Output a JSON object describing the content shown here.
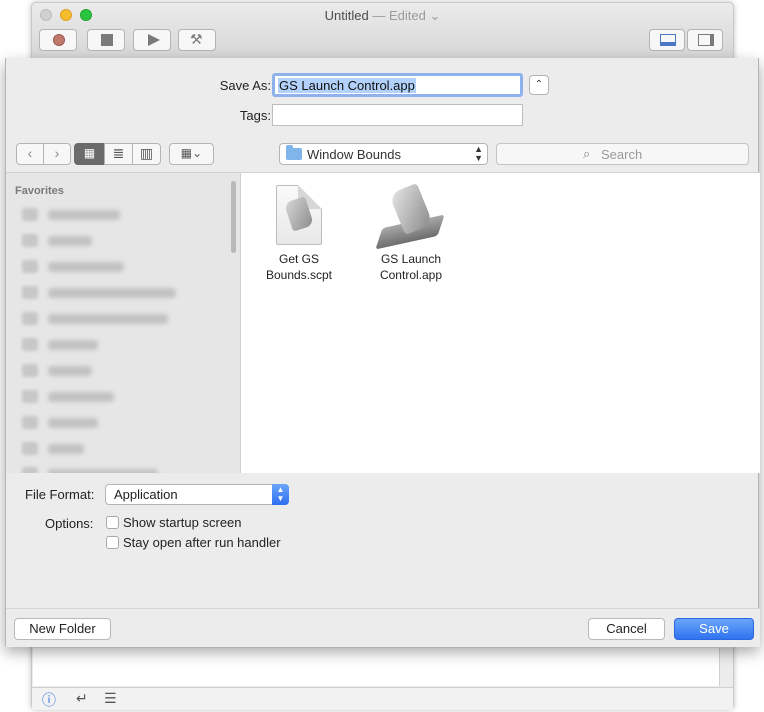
{
  "editor": {
    "title": "Untitled",
    "title_status": "— Edited",
    "title_chevron": "⌄",
    "toolbar_icons": [
      "record-icon",
      "stop-icon",
      "run-icon",
      "compile-icon",
      "split-horizontal-icon",
      "split-vertical-icon"
    ],
    "footer_icons": [
      "info-icon",
      "return-icon",
      "list-icon"
    ]
  },
  "save_dialog": {
    "save_as_label": "Save As:",
    "save_as_value": "GS Launch Control.app",
    "tags_label": "Tags:",
    "tags_value": "",
    "location": "Window Bounds",
    "search_placeholder": "Search",
    "sidebar": {
      "header": "Favorites",
      "item_count_visible": 11
    },
    "files": [
      {
        "name": "Get GS Bounds.scpt",
        "line1": "Get GS",
        "line2": "Bounds.scpt",
        "icon": "script-document-icon"
      },
      {
        "name": "GS Launch Control.app",
        "line1": "GS Launch",
        "line2": "Control.app",
        "icon": "script-app-icon"
      }
    ],
    "file_format_label": "File Format:",
    "file_format_value": "Application",
    "options_label": "Options:",
    "options": [
      {
        "label": "Show startup screen",
        "checked": false
      },
      {
        "label": "Stay open after run handler",
        "checked": false
      }
    ],
    "new_folder_label": "New Folder",
    "cancel_label": "Cancel",
    "save_label": "Save"
  },
  "colors": {
    "accent": "#3478f6",
    "selection": "#b3d2fb",
    "folder": "#7fb5ea"
  }
}
